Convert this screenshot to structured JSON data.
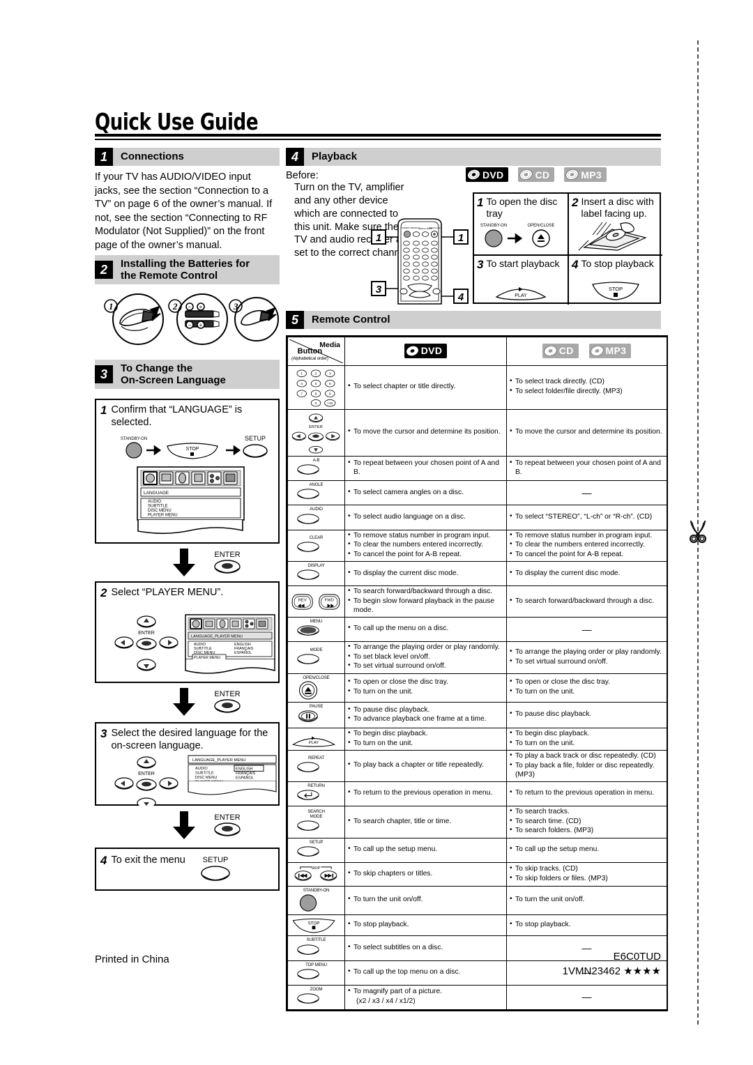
{
  "document": {
    "title": "Quick Use Guide",
    "footer_left": "Printed in China",
    "footer_right_1": "E6C0TUD",
    "footer_right_2": "1VMN23462 ★★★★"
  },
  "sections": {
    "connections": {
      "num": "1",
      "title": "Connections",
      "body": "If your TV has AUDIO/VIDEO input jacks, see the section “Connection to a TV” on page 6 of the owner’s manual. If not, see the section “Connecting to RF Modulator (Not Supplied)” on the front page of the owner’s manual."
    },
    "batteries": {
      "num": "2",
      "title_line1": "Installing the Batteries for",
      "title_line2": "the Remote Control",
      "figure_labels": [
        "1",
        "2",
        "3"
      ]
    },
    "language": {
      "num": "3",
      "title_line1": "To Change the",
      "title_line2": "On-Screen Language",
      "steps": [
        {
          "num": "1",
          "text": "Confirm that “LANGUAGE” is selected.",
          "keys": [
            "STANDBY-ON",
            "STOP",
            "SETUP"
          ],
          "osd": {
            "tab_label": "LANGUAGE",
            "items": [
              "AUDIO",
              "SUBTITLE",
              "DISC MENU",
              "PLAYER MENU"
            ],
            "values": []
          }
        },
        {
          "num": "2",
          "text": "Select “PLAYER MENU”.",
          "keys": [
            "ENTER"
          ],
          "osd": {
            "tab_label": "LANGUAGE_PLAYER MENU",
            "items": [
              "AUDIO",
              "SUBTITLE",
              "DISC MENU",
              "PLAYER MENU"
            ],
            "values": [
              "ENGLISH",
              "FRANÇAIS",
              "ESPAÑOL"
            ],
            "highlight": "PLAYER MENU"
          }
        },
        {
          "num": "3",
          "text": "Select the desired language for the on-screen language.",
          "keys": [
            "ENTER"
          ],
          "osd": {
            "tab_label": "LANGUAGE_PLAYER MENU",
            "items": [
              "AUDIO",
              "SUBTITLE",
              "DISC MENU",
              "PLAYER MENU"
            ],
            "values": [
              "ENGLISH",
              "FRANÇAIS",
              "ESPAÑOL"
            ],
            "highlight": "ENGLISH"
          }
        },
        {
          "num": "4",
          "text": "To exit the menu",
          "keys": [
            "SETUP"
          ],
          "osd": null
        }
      ],
      "arrow_labels": [
        "ENTER",
        "ENTER",
        "ENTER"
      ]
    },
    "playback": {
      "num": "4",
      "title": "Playback",
      "before_label": "Before:",
      "before_text": "Turn on the TV, amplifier and any other device which are connected to this unit. Make sure the TV and audio receiver are set to the correct channel.",
      "remote_callouts": [
        "1",
        "1",
        "3",
        "4"
      ],
      "badges": [
        "DVD",
        "CD",
        "MP3"
      ],
      "cells": [
        {
          "num": "1",
          "text": "To open the disc tray",
          "keys": [
            "STANDBY-ON",
            "OPEN/CLOSE"
          ]
        },
        {
          "num": "2",
          "text": "Insert a disc with label facing up.",
          "keys": []
        },
        {
          "num": "3",
          "text": "To start playback",
          "keys": [
            "PLAY"
          ]
        },
        {
          "num": "4",
          "text": "To stop playback",
          "keys": [
            "STOP"
          ]
        }
      ]
    },
    "remote": {
      "num": "5",
      "title": "Remote Control",
      "header": {
        "button_label": "Button",
        "button_sub": "(Alphabetical order)",
        "media_label": "Media",
        "col_dvd": "DVD",
        "col_cd": "CD",
        "col_mp3": "MP3"
      },
      "rows": [
        {
          "key": "numbers",
          "dvd": [
            "To select chapter or title directly."
          ],
          "cd": [
            "To select track directly. (CD)",
            "To select folder/file directly. (MP3)"
          ]
        },
        {
          "key": "cursor-enter",
          "key_label": "ENTER",
          "dvd": [
            "To move the cursor and determine its position."
          ],
          "cd": [
            "To move the cursor and determine its position."
          ]
        },
        {
          "key": "A-B",
          "dvd": [
            "To repeat between your chosen point of A and B."
          ],
          "cd": [
            "To repeat between your chosen point of A and B."
          ]
        },
        {
          "key": "ANGLE",
          "dvd": [
            "To select camera angles on a disc."
          ],
          "cd": "—"
        },
        {
          "key": "AUDIO",
          "dvd": [
            "To select audio language on a disc."
          ],
          "cd": [
            "To select “STEREO”, “L-ch” or “R-ch”. (CD)"
          ]
        },
        {
          "key": "CLEAR",
          "dvd": [
            "To remove status number in program input.",
            "To clear the numbers entered incorrectly.",
            "To cancel the point for A-B repeat."
          ],
          "cd": [
            "To remove status number in program input.",
            "To clear the numbers entered incorrectly.",
            "To cancel the point for A-B repeat."
          ]
        },
        {
          "key": "DISPLAY",
          "dvd": [
            "To display the current disc mode."
          ],
          "cd": [
            "To display the current disc mode."
          ]
        },
        {
          "key": "REV/FWD",
          "key_label_a": "REV",
          "key_label_b": "FWD",
          "dvd": [
            "To search forward/backward through a disc.",
            "To begin slow forward playback in the pause mode."
          ],
          "cd": [
            "To search forward/backward through a disc."
          ]
        },
        {
          "key": "MENU",
          "dvd": [
            "To call up the menu on a disc."
          ],
          "cd": "—"
        },
        {
          "key": "MODE",
          "dvd": [
            "To arrange the playing order or play randomly.",
            "To set black level on/off.",
            "To set virtual surround on/off."
          ],
          "cd": [
            "To arrange the playing order or play randomly.",
            "To set virtual surround on/off."
          ]
        },
        {
          "key": "OPEN/CLOSE",
          "dvd": [
            "To open or close the disc tray.",
            "To turn on the unit."
          ],
          "cd": [
            "To open or close the disc tray.",
            "To turn on the unit."
          ]
        },
        {
          "key": "PAUSE",
          "dvd": [
            "To pause disc playback.",
            "To advance playback one frame at a time."
          ],
          "cd": [
            "To pause disc playback."
          ]
        },
        {
          "key": "PLAY",
          "dvd": [
            "To begin disc playback.",
            "To turn on the unit."
          ],
          "cd": [
            "To begin disc playback.",
            "To turn on the unit."
          ]
        },
        {
          "key": "REPEAT",
          "dvd": [
            "To play back a chapter or title repeatedly."
          ],
          "cd": [
            "To play a back track or disc repeatedly. (CD)",
            "To play back a file, folder or disc repeatedly. (MP3)"
          ]
        },
        {
          "key": "RETURN",
          "dvd": [
            "To return to the previous operation in menu."
          ],
          "cd": [
            "To return to the previous operation in menu."
          ]
        },
        {
          "key": "SEARCH MODE",
          "key_label_a": "SEARCH",
          "key_label_b": "MODE",
          "dvd": [
            "To search chapter, title or time."
          ],
          "cd": [
            "To search tracks.",
            "To search time. (CD)",
            "To search folders. (MP3)"
          ]
        },
        {
          "key": "SETUP",
          "dvd": [
            "To call up the setup menu."
          ],
          "cd": [
            "To call up the setup menu."
          ]
        },
        {
          "key": "SKIP",
          "dvd": [
            "To skip chapters or titles."
          ],
          "cd": [
            "To skip tracks. (CD)",
            "To skip folders or files. (MP3)"
          ]
        },
        {
          "key": "STANDBY-ON",
          "dvd": [
            "To turn the unit on/off."
          ],
          "cd": [
            "To turn the unit on/off."
          ]
        },
        {
          "key": "STOP",
          "dvd": [
            "To stop playback."
          ],
          "cd": [
            "To stop playback."
          ]
        },
        {
          "key": "SUBTITLE",
          "dvd": [
            "To select subtitles on a disc."
          ],
          "cd": "—"
        },
        {
          "key": "TOP MENU",
          "dvd": [
            "To call up the top menu on a disc."
          ],
          "cd": "—"
        },
        {
          "key": "ZOOM",
          "dvd": [
            "To magnify part of a picture.",
            "(x2 / x3 / x4 / x1/2)"
          ],
          "cd": "—"
        }
      ]
    }
  }
}
